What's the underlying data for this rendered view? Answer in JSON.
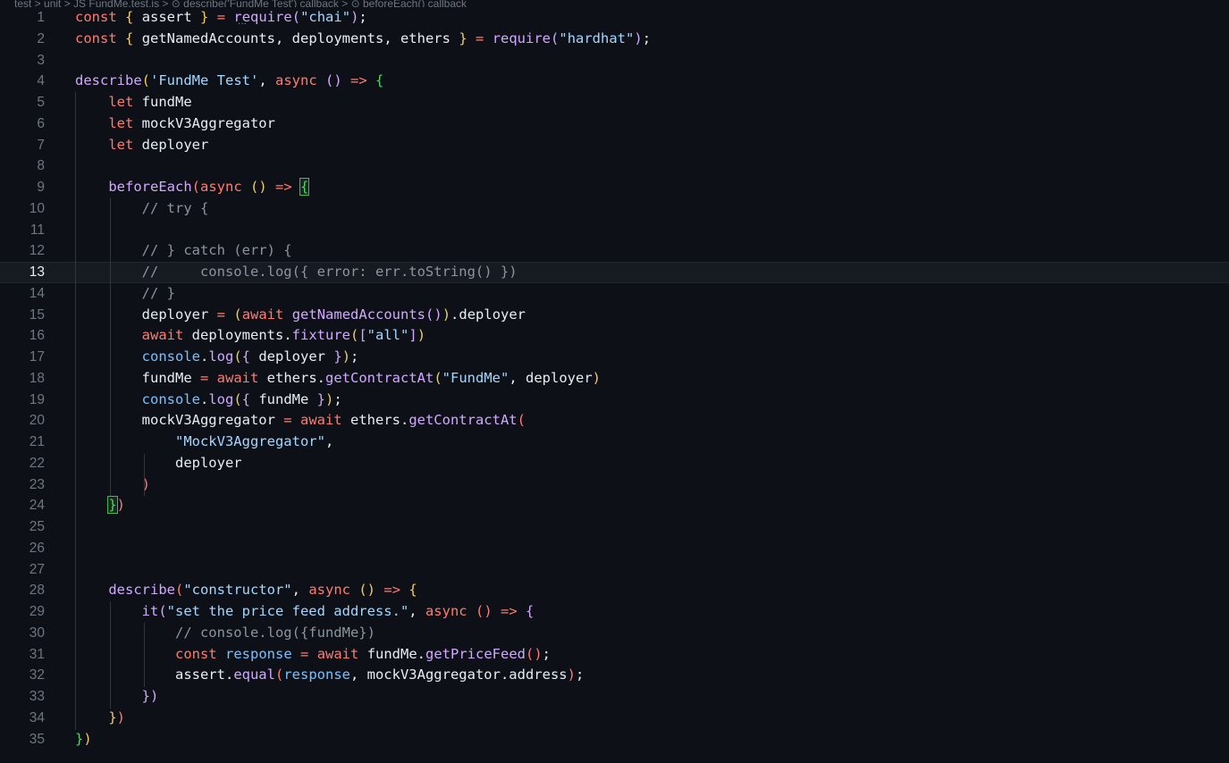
{
  "breadcrumb": "test > unit > JS FundMe.test.js > ⊙ describe('FundMe Test') callback > ⊙ beforeEach() callback",
  "current_line": 13,
  "lines": [
    {
      "n": "1",
      "t": [
        [
          "t-kw",
          "const"
        ],
        [
          "t-punc",
          " "
        ],
        [
          "b1",
          "{"
        ],
        [
          "t-var",
          " assert "
        ],
        [
          "b1",
          "}"
        ],
        [
          "t-punc",
          " "
        ],
        [
          "t-op",
          "="
        ],
        [
          "t-punc",
          " "
        ],
        [
          "t-fn",
          "require"
        ],
        [
          "b2",
          "("
        ],
        [
          "t-str",
          "\"chai\""
        ],
        [
          "b2",
          ")"
        ],
        [
          "t-punc",
          ";"
        ]
      ]
    },
    {
      "n": "2",
      "t": [
        [
          "t-kw",
          "const"
        ],
        [
          "t-punc",
          " "
        ],
        [
          "b1",
          "{"
        ],
        [
          "t-var",
          " getNamedAccounts, deployments, ethers "
        ],
        [
          "b1",
          "}"
        ],
        [
          "t-punc",
          " "
        ],
        [
          "t-op",
          "="
        ],
        [
          "t-punc",
          " "
        ],
        [
          "t-fn",
          "require"
        ],
        [
          "b2",
          "("
        ],
        [
          "t-str",
          "\"hardhat\""
        ],
        [
          "b2",
          ")"
        ],
        [
          "t-punc",
          ";"
        ]
      ]
    },
    {
      "n": "3",
      "t": []
    },
    {
      "n": "4",
      "t": [
        [
          "t-fn",
          "describe"
        ],
        [
          "b1",
          "("
        ],
        [
          "t-str",
          "'FundMe Test'"
        ],
        [
          "t-punc",
          ", "
        ],
        [
          "t-kw",
          "async"
        ],
        [
          "t-punc",
          " "
        ],
        [
          "b2",
          "()"
        ],
        [
          "t-punc",
          " "
        ],
        [
          "t-kw",
          "=>"
        ],
        [
          "t-punc",
          " "
        ],
        [
          "b4",
          "{"
        ]
      ]
    },
    {
      "n": "5",
      "t": [
        [
          "t-punc",
          "    "
        ],
        [
          "t-kw",
          "let"
        ],
        [
          "t-var",
          " fundMe"
        ]
      ]
    },
    {
      "n": "6",
      "t": [
        [
          "t-punc",
          "    "
        ],
        [
          "t-kw",
          "let"
        ],
        [
          "t-var",
          " mockV3Aggregator"
        ]
      ]
    },
    {
      "n": "7",
      "t": [
        [
          "t-punc",
          "    "
        ],
        [
          "t-kw",
          "let"
        ],
        [
          "t-var",
          " deployer"
        ]
      ]
    },
    {
      "n": "8",
      "t": []
    },
    {
      "n": "9",
      "t": [
        [
          "t-punc",
          "    "
        ],
        [
          "t-fn",
          "beforeEach"
        ],
        [
          "b3",
          "("
        ],
        [
          "t-kw",
          "async"
        ],
        [
          "t-punc",
          " "
        ],
        [
          "b1",
          "()"
        ],
        [
          "t-punc",
          " "
        ],
        [
          "t-kw",
          "=>"
        ],
        [
          "t-punc",
          " "
        ],
        [
          "b4 bm",
          "{"
        ]
      ]
    },
    {
      "n": "10",
      "t": [
        [
          "t-punc",
          "        "
        ],
        [
          "t-cm",
          "// try {"
        ]
      ]
    },
    {
      "n": "11",
      "t": []
    },
    {
      "n": "12",
      "t": [
        [
          "t-punc",
          "        "
        ],
        [
          "t-cm",
          "// } catch (err) {"
        ]
      ]
    },
    {
      "n": "13",
      "t": [
        [
          "t-punc",
          "        "
        ],
        [
          "t-cm",
          "//     console.log({ error: err.toString() })"
        ]
      ]
    },
    {
      "n": "14",
      "t": [
        [
          "t-punc",
          "        "
        ],
        [
          "t-cm",
          "// }"
        ]
      ]
    },
    {
      "n": "15",
      "t": [
        [
          "t-punc",
          "        "
        ],
        [
          "t-var",
          "deployer "
        ],
        [
          "t-op",
          "="
        ],
        [
          "t-punc",
          " "
        ],
        [
          "b1",
          "("
        ],
        [
          "t-kw",
          "await"
        ],
        [
          "t-punc",
          " "
        ],
        [
          "t-fn",
          "getNamedAccounts"
        ],
        [
          "b2",
          "()"
        ],
        [
          "b1",
          ")"
        ],
        [
          "t-var",
          ".deployer"
        ]
      ]
    },
    {
      "n": "16",
      "t": [
        [
          "t-punc",
          "        "
        ],
        [
          "t-kw",
          "await"
        ],
        [
          "t-var",
          " deployments."
        ],
        [
          "t-fn",
          "fixture"
        ],
        [
          "b1",
          "("
        ],
        [
          "b2",
          "["
        ],
        [
          "t-str",
          "\"all\""
        ],
        [
          "b2",
          "]"
        ],
        [
          "b1",
          ")"
        ]
      ]
    },
    {
      "n": "17",
      "t": [
        [
          "t-punc",
          "        "
        ],
        [
          "t-const",
          "console"
        ],
        [
          "t-punc",
          "."
        ],
        [
          "t-fn",
          "log"
        ],
        [
          "b1",
          "("
        ],
        [
          "b2",
          "{"
        ],
        [
          "t-var",
          " deployer "
        ],
        [
          "b2",
          "}"
        ],
        [
          "b1",
          ")"
        ],
        [
          "t-punc",
          ";"
        ]
      ]
    },
    {
      "n": "18",
      "t": [
        [
          "t-punc",
          "        "
        ],
        [
          "t-var",
          "fundMe "
        ],
        [
          "t-op",
          "="
        ],
        [
          "t-punc",
          " "
        ],
        [
          "t-kw",
          "await"
        ],
        [
          "t-var",
          " ethers."
        ],
        [
          "t-fn",
          "getContractAt"
        ],
        [
          "b1",
          "("
        ],
        [
          "t-str",
          "\"FundMe\""
        ],
        [
          "t-punc",
          ", deployer"
        ],
        [
          "b1",
          ")"
        ]
      ]
    },
    {
      "n": "19",
      "t": [
        [
          "t-punc",
          "        "
        ],
        [
          "t-const",
          "console"
        ],
        [
          "t-punc",
          "."
        ],
        [
          "t-fn",
          "log"
        ],
        [
          "b1",
          "("
        ],
        [
          "b2",
          "{"
        ],
        [
          "t-var",
          " fundMe "
        ],
        [
          "b2",
          "}"
        ],
        [
          "b1",
          ")"
        ],
        [
          "t-punc",
          ";"
        ]
      ]
    },
    {
      "n": "20",
      "t": [
        [
          "t-punc",
          "        "
        ],
        [
          "t-var",
          "mockV3Aggregator "
        ],
        [
          "t-op",
          "="
        ],
        [
          "t-punc",
          " "
        ],
        [
          "t-kw",
          "await"
        ],
        [
          "t-var",
          " ethers."
        ],
        [
          "t-fn",
          "getContractAt"
        ],
        [
          "b3",
          "("
        ]
      ]
    },
    {
      "n": "21",
      "t": [
        [
          "t-punc",
          "            "
        ],
        [
          "t-str",
          "\"MockV3Aggregator\""
        ],
        [
          "t-punc",
          ","
        ]
      ]
    },
    {
      "n": "22",
      "t": [
        [
          "t-punc",
          "            "
        ],
        [
          "t-var",
          "deployer"
        ]
      ]
    },
    {
      "n": "23",
      "t": [
        [
          "t-punc",
          "        "
        ],
        [
          "b3",
          ")"
        ]
      ]
    },
    {
      "n": "24",
      "t": [
        [
          "t-punc",
          "    "
        ],
        [
          "b4 bm",
          "}"
        ],
        [
          "b3",
          ")"
        ]
      ]
    },
    {
      "n": "25",
      "t": []
    },
    {
      "n": "26",
      "t": []
    },
    {
      "n": "27",
      "t": []
    },
    {
      "n": "28",
      "t": [
        [
          "t-punc",
          "    "
        ],
        [
          "t-fn",
          "describe"
        ],
        [
          "b3",
          "("
        ],
        [
          "t-str",
          "\"constructor\""
        ],
        [
          "t-punc",
          ", "
        ],
        [
          "t-kw",
          "async"
        ],
        [
          "t-punc",
          " "
        ],
        [
          "b1",
          "()"
        ],
        [
          "t-punc",
          " "
        ],
        [
          "t-kw",
          "=>"
        ],
        [
          "t-punc",
          " "
        ],
        [
          "b1",
          "{"
        ]
      ]
    },
    {
      "n": "29",
      "t": [
        [
          "t-punc",
          "        "
        ],
        [
          "t-fn",
          "it"
        ],
        [
          "b2",
          "("
        ],
        [
          "t-str",
          "\"set the price feed address.\""
        ],
        [
          "t-punc",
          ", "
        ],
        [
          "t-kw",
          "async"
        ],
        [
          "t-punc",
          " "
        ],
        [
          "b3",
          "()"
        ],
        [
          "t-punc",
          " "
        ],
        [
          "t-kw",
          "=>"
        ],
        [
          "t-punc",
          " "
        ],
        [
          "b2",
          "{"
        ]
      ]
    },
    {
      "n": "30",
      "t": [
        [
          "t-punc",
          "            "
        ],
        [
          "t-cm",
          "// console.log({fundMe})"
        ]
      ]
    },
    {
      "n": "31",
      "t": [
        [
          "t-punc",
          "            "
        ],
        [
          "t-kw",
          "const"
        ],
        [
          "t-punc",
          " "
        ],
        [
          "t-const",
          "response"
        ],
        [
          "t-punc",
          " "
        ],
        [
          "t-op",
          "="
        ],
        [
          "t-punc",
          " "
        ],
        [
          "t-kw",
          "await"
        ],
        [
          "t-var",
          " fundMe."
        ],
        [
          "t-fn",
          "getPriceFeed"
        ],
        [
          "b3",
          "()"
        ],
        [
          "t-punc",
          ";"
        ]
      ]
    },
    {
      "n": "32",
      "t": [
        [
          "t-punc",
          "            "
        ],
        [
          "t-var",
          "assert."
        ],
        [
          "t-fn",
          "equal"
        ],
        [
          "b3",
          "("
        ],
        [
          "t-const",
          "response"
        ],
        [
          "t-punc",
          ", mockV3Aggregator.address"
        ],
        [
          "b3",
          ")"
        ],
        [
          "t-punc",
          ";"
        ]
      ]
    },
    {
      "n": "33",
      "t": [
        [
          "t-punc",
          "        "
        ],
        [
          "b2",
          "}"
        ],
        [
          "b2",
          ")"
        ]
      ]
    },
    {
      "n": "34",
      "t": [
        [
          "t-punc",
          "    "
        ],
        [
          "b1",
          "}"
        ],
        [
          "b3",
          ")"
        ]
      ]
    },
    {
      "n": "35",
      "t": [
        [
          "b4",
          "}"
        ],
        [
          "b1",
          ")"
        ]
      ]
    }
  ]
}
